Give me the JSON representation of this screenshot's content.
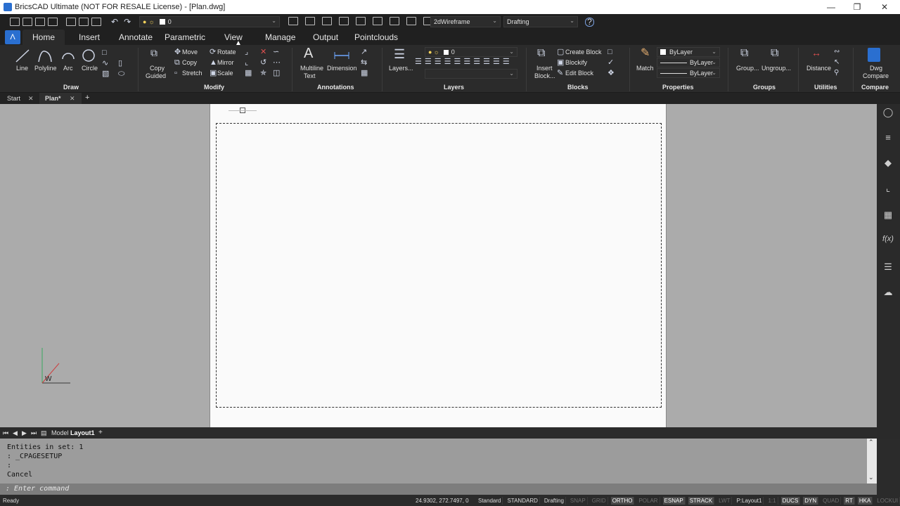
{
  "window": {
    "title": "BricsCAD Ultimate (NOT FOR RESALE License) - [Plan.dwg]"
  },
  "qat": {
    "layer_value": "0",
    "visual_style": "2dWireframe",
    "workspace": "Drafting"
  },
  "ribbon_tabs": [
    "Home",
    "Insert",
    "Annotate",
    "Parametric",
    "View",
    "Manage",
    "Output",
    "Pointclouds"
  ],
  "panels": {
    "draw": {
      "title": "Draw",
      "line": "Line",
      "polyline": "Polyline",
      "arc": "Arc",
      "circle": "Circle"
    },
    "modify": {
      "title": "Modify",
      "copy_guided_1": "Copy",
      "copy_guided_2": "Guided",
      "move": "Move",
      "copy": "Copy",
      "stretch": "Stretch",
      "rotate": "Rotate",
      "mirror": "Mirror",
      "scale": "Scale"
    },
    "annotations": {
      "title": "Annotations",
      "mtext_1": "Multiline",
      "mtext_2": "Text",
      "dimension": "Dimension"
    },
    "layers": {
      "title": "Layers",
      "layers": "Layers...",
      "layer_value": "0"
    },
    "blocks": {
      "title": "Blocks",
      "insert_1": "Insert",
      "insert_2": "Block...",
      "create": "Create Block",
      "blockify": "Blockify",
      "edit": "Edit Block"
    },
    "properties": {
      "title": "Properties",
      "match": "Match",
      "color": "ByLayer",
      "linetype": "ByLayer",
      "lineweight": "ByLayer"
    },
    "groups": {
      "title": "Groups",
      "group": "Group...",
      "ungroup": "Ungroup..."
    },
    "utilities": {
      "title": "Utilities",
      "distance": "Distance"
    },
    "compare": {
      "title": "Compare",
      "dwg_1": "Dwg",
      "dwg_2": "Compare"
    }
  },
  "doc_tabs": {
    "start": "Start",
    "plan": "Plan*"
  },
  "layout_tabs": {
    "model": "Model",
    "layout": "Layout1"
  },
  "ucs": {
    "w": "W"
  },
  "command": {
    "lines": [
      "Entities in set: 1",
      ": _CPAGESETUP",
      ":",
      "Cancel"
    ],
    "prompt": ": Enter command"
  },
  "status": {
    "ready": "Ready",
    "coords": "24.9302, 272.7497, 0",
    "items": [
      {
        "label": "Standard",
        "state": "text"
      },
      {
        "label": "STANDARD",
        "state": "text"
      },
      {
        "label": "Drafting",
        "state": "text"
      },
      {
        "label": "SNAP",
        "state": "off"
      },
      {
        "label": "GRID",
        "state": "off"
      },
      {
        "label": "ORTHO",
        "state": "on"
      },
      {
        "label": "POLAR",
        "state": "off"
      },
      {
        "label": "ESNAP",
        "state": "on"
      },
      {
        "label": "STRACK",
        "state": "on"
      },
      {
        "label": "LWT",
        "state": "off"
      },
      {
        "label": "P:Layout1",
        "state": "text"
      },
      {
        "label": "1:1",
        "state": "off"
      },
      {
        "label": "DUCS",
        "state": "on"
      },
      {
        "label": "DYN",
        "state": "on"
      },
      {
        "label": "QUAD",
        "state": "off"
      },
      {
        "label": "RT",
        "state": "on"
      },
      {
        "label": "HKA",
        "state": "on"
      },
      {
        "label": "LOCKUI",
        "state": "off"
      },
      {
        "label": "None",
        "state": "text"
      }
    ]
  },
  "colors": {
    "accent": "#2a6fd0",
    "paper": "#fafafa",
    "canvas": "#ababab",
    "ribbon": "#2b2b2b"
  }
}
